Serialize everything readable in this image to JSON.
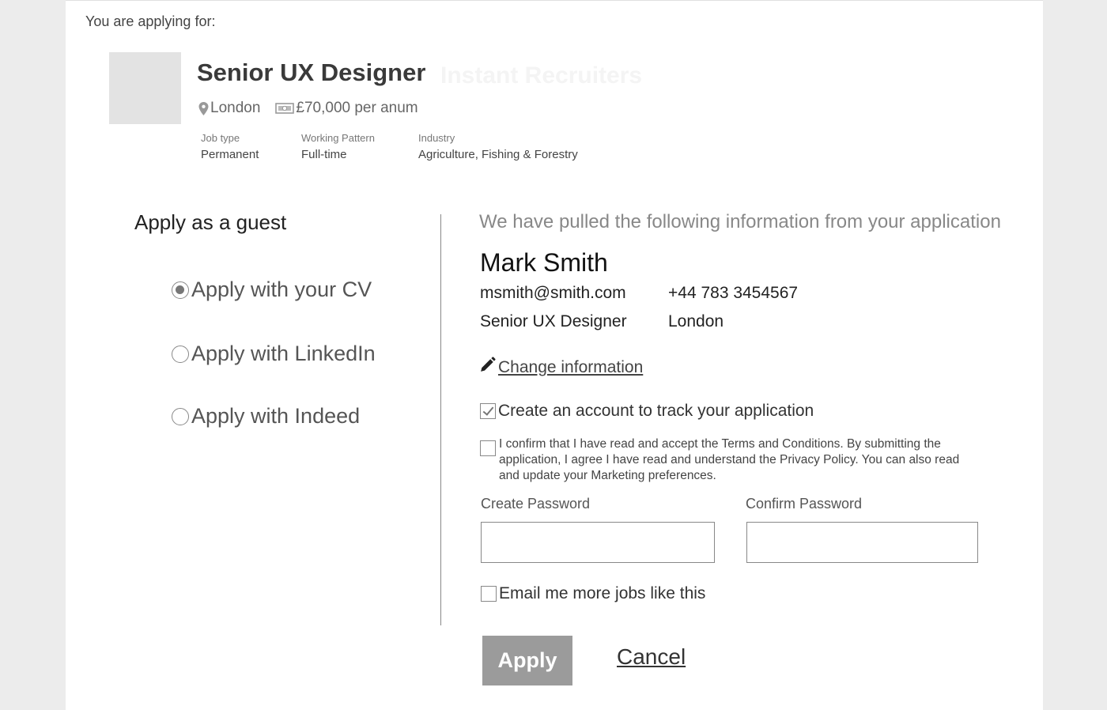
{
  "header": {
    "applying_for": "You are applying for:"
  },
  "job": {
    "title": "Senior UX Designer",
    "title_faded_text": "Instant Recruiters",
    "location": "London",
    "salary": "£70,000 per anum",
    "meta": [
      {
        "label": "Job type",
        "value": "Permanent"
      },
      {
        "label": "Working Pattern",
        "value": "Full-time"
      },
      {
        "label": "Industry",
        "value": "Agriculture, Fishing & Forestry"
      }
    ]
  },
  "guest": {
    "title": "Apply as a guest",
    "options": [
      {
        "label": "Apply with your CV",
        "selected": true
      },
      {
        "label": "Apply with LinkedIn",
        "selected": false
      },
      {
        "label": "Apply with Indeed",
        "selected": false
      }
    ]
  },
  "profile": {
    "intro": "We have pulled the following information from your application",
    "name": "Mark Smith",
    "email": "msmith@smith.com",
    "phone": "+44 783 3454567",
    "role": "Senior UX Designer",
    "location": "London",
    "change_link": "Change information"
  },
  "account": {
    "create_label": "Create an account to track your application",
    "create_checked": true,
    "terms_text": "I confirm that I have read and accept the Terms and Conditions. By submitting the application, I agree I have read and understand the Privacy Policy. You can also read and update your Marketing preferences.",
    "terms_checked": false,
    "create_password_label": "Create Password",
    "confirm_password_label": "Confirm Password",
    "email_jobs_label": "Email me more jobs like this",
    "email_jobs_checked": false
  },
  "actions": {
    "apply_label": "Apply",
    "cancel_label": "Cancel"
  },
  "colors": {
    "page_bg": "#ececec",
    "card_bg": "#ffffff",
    "apply_button": "#9b9b9b",
    "logo_placeholder": "#e3e3e3"
  },
  "icons": [
    "map-pin-icon",
    "money-icon",
    "pencil-icon",
    "check-icon"
  ]
}
